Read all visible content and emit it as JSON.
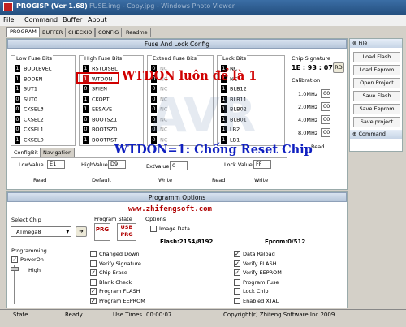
{
  "window": {
    "title": "PROGISP (Ver 1.68)",
    "behind_title": "FUSE.img - Copy.jpg - Windows Photo Viewer"
  },
  "menu": [
    "File",
    "Command",
    "Buffer",
    "About"
  ],
  "tabs": [
    "PROGRAM",
    "BUFFER",
    "CHECKIO",
    "CONFIG",
    "Readme"
  ],
  "fuse_section": {
    "title": "Fuse And Lock Config"
  },
  "low_fuse": {
    "title": "Low Fuse Bits",
    "bits": [
      {
        "v": "1",
        "name": "BODLEVEL"
      },
      {
        "v": "1",
        "name": "BODEN"
      },
      {
        "v": "1",
        "name": "SUT1"
      },
      {
        "v": "0",
        "name": "SUT0"
      },
      {
        "v": "0",
        "name": "CKSEL3"
      },
      {
        "v": "0",
        "name": "CKSEL2"
      },
      {
        "v": "0",
        "name": "CKSEL1"
      },
      {
        "v": "1",
        "name": "CKSEL0"
      }
    ]
  },
  "high_fuse": {
    "title": "High Fuse Bits",
    "bits": [
      {
        "v": "1",
        "name": "RSTDISBL"
      },
      {
        "v": "1",
        "name": "WTDON"
      },
      {
        "v": "0",
        "name": "SPIEN"
      },
      {
        "v": "1",
        "name": "CKOPT"
      },
      {
        "v": "1",
        "name": "EESAVE"
      },
      {
        "v": "0",
        "name": "BOOTSZ1"
      },
      {
        "v": "0",
        "name": "BOOTSZ0"
      },
      {
        "v": "1",
        "name": "BOOTRST"
      }
    ]
  },
  "extend_fuse": {
    "title": "Extend Fuse Bits",
    "bits": [
      {
        "v": "0",
        "name": "NC"
      },
      {
        "v": "0",
        "name": "NC"
      },
      {
        "v": "0",
        "name": "NC"
      },
      {
        "v": "0",
        "name": "NC"
      },
      {
        "v": "0",
        "name": "NC"
      },
      {
        "v": "0",
        "name": "NC"
      },
      {
        "v": "0",
        "name": "NC"
      },
      {
        "v": "0",
        "name": "NC"
      }
    ]
  },
  "lock_bits": {
    "title": "Lock Bits",
    "bits": [
      {
        "v": "1",
        "name": "NC"
      },
      {
        "v": "1",
        "name": "NC"
      },
      {
        "v": "1",
        "name": "BLB12"
      },
      {
        "v": "1",
        "name": "BLB11"
      },
      {
        "v": "1",
        "name": "BLB02"
      },
      {
        "v": "1",
        "name": "BLB01"
      },
      {
        "v": "1",
        "name": "LB2"
      },
      {
        "v": "1",
        "name": "LB1"
      }
    ]
  },
  "chip_signature": {
    "title": "Chip Signature",
    "value": "1E : 93 : 07",
    "rd": "RD"
  },
  "calibration": {
    "title": "Calibration",
    "rows": [
      {
        "label": "1.0MHz",
        "value": "00"
      },
      {
        "label": "2.0MHz",
        "value": "00"
      },
      {
        "label": "4.0MHz",
        "value": "00"
      },
      {
        "label": "8.0MHz",
        "value": "00"
      }
    ]
  },
  "bottom_tabs": [
    "ConfigBit",
    "Navigation"
  ],
  "values": {
    "low_label": "LowValue",
    "low": "E1",
    "high_label": "HighValue",
    "high": "D9",
    "ext_label": "ExtValue",
    "ext": "0",
    "lock_label": "Lock Value",
    "lock": "FF"
  },
  "actions": {
    "read": "Read",
    "default": "Default",
    "write": "Write"
  },
  "overlay": {
    "wtdon_note": "WTDON luôn để là 1",
    "reset_note": "WTDON=1: Chống Reset Chip",
    "url": "www.zhifengsoft.com",
    "watermark": "AVR"
  },
  "program_options": {
    "title": "Programm Options"
  },
  "select_chip": {
    "label": "Select Chip",
    "value": "ATmega8"
  },
  "program_state": {
    "label": "Program State",
    "prg": "PRG",
    "usb": "USB"
  },
  "options": {
    "label": "Options",
    "image_data": "Image Data",
    "flash": "Flash:2154/8192",
    "eprom": "Eprom:0/512"
  },
  "programming": {
    "label": "Programming",
    "power_on": "PowerOn",
    "level": "High"
  },
  "checks_mid": [
    {
      "checked": false,
      "label": "Changed Down"
    },
    {
      "checked": false,
      "label": "Verify Signature"
    },
    {
      "checked": true,
      "label": "Chip Erase"
    },
    {
      "checked": false,
      "label": "Blank Check"
    },
    {
      "checked": true,
      "label": "Program FLASH"
    },
    {
      "checked": true,
      "label": "Program EEPROM"
    }
  ],
  "checks_right": [
    {
      "checked": true,
      "label": "Data Reload"
    },
    {
      "checked": true,
      "label": "Verify FLASH"
    },
    {
      "checked": true,
      "label": "Verify EEPROM"
    },
    {
      "checked": false,
      "label": "Program Fuse"
    },
    {
      "checked": false,
      "label": "Lock Chip"
    },
    {
      "checked": false,
      "label": "Enabled XTAL"
    }
  ],
  "side": {
    "file_title": "File",
    "buttons": [
      "Load Flash",
      "Load Eeprom",
      "Open Project",
      "Save Flash",
      "Save Eeprom",
      "Save project"
    ],
    "command_title": "Command"
  },
  "status": {
    "state_label": "State",
    "state": "Ready",
    "time_label": "Use Times",
    "time": "00:00:07",
    "copyright": "Copyright(r) Zhifeng Software,Inc 2009"
  },
  "colors": {
    "fuse_one": "#000000",
    "fuse_highlight": "#c01010",
    "note_red": "#d00000",
    "note_blue": "#1020c0"
  }
}
